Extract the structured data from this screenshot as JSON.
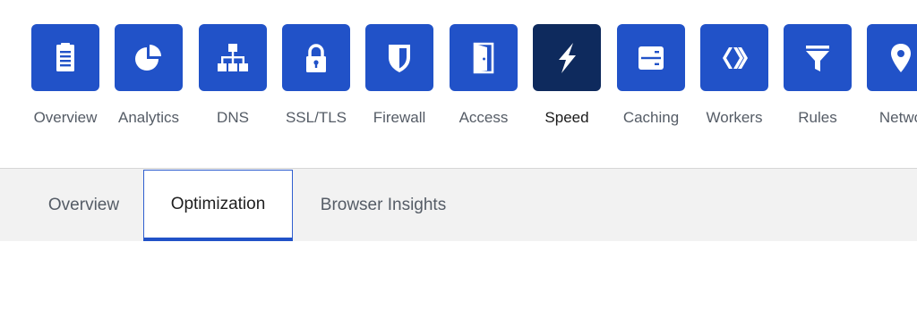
{
  "nav": {
    "items": [
      {
        "label": "Overview",
        "icon": "clipboard-icon"
      },
      {
        "label": "Analytics",
        "icon": "pie-chart-icon"
      },
      {
        "label": "DNS",
        "icon": "network-tree-icon"
      },
      {
        "label": "SSL/TLS",
        "icon": "lock-icon"
      },
      {
        "label": "Firewall",
        "icon": "shield-icon"
      },
      {
        "label": "Access",
        "icon": "door-icon"
      },
      {
        "label": "Speed",
        "icon": "lightning-icon",
        "active": true
      },
      {
        "label": "Caching",
        "icon": "server-icon"
      },
      {
        "label": "Workers",
        "icon": "workers-chevrons-icon"
      },
      {
        "label": "Rules",
        "icon": "filter-icon"
      },
      {
        "label": "Netwo",
        "icon": "location-pin-icon"
      }
    ]
  },
  "subnav": {
    "tabs": [
      {
        "label": "Overview"
      },
      {
        "label": "Optimization",
        "active": true
      },
      {
        "label": "Browser Insights"
      }
    ]
  },
  "colors": {
    "tile": "#2152c8",
    "tile_active": "#0e2a5d",
    "tab_indicator": "#2152c8",
    "subnav_bg": "#f2f2f2"
  }
}
